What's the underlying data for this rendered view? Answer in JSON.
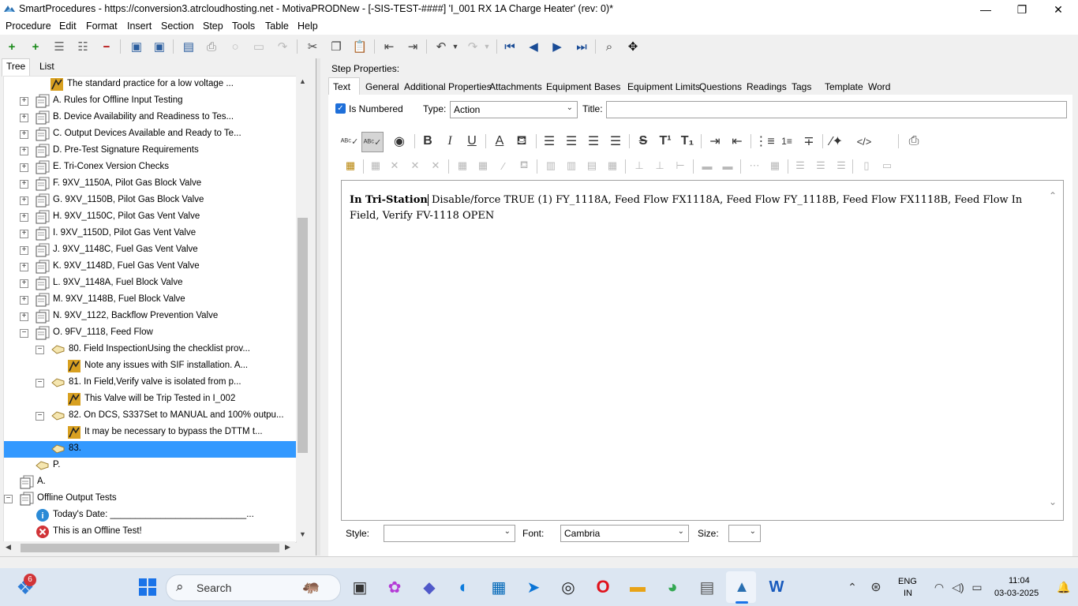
{
  "window": {
    "title": "SmartProcedures - https://conversion3.atrcloudhosting.net - MotivaPRODNew - [-SIS-TEST-####] 'I_001 RX 1A Charge Heater' (rev: 0)*",
    "minimize": "—",
    "maximize": "❐",
    "close": "✕"
  },
  "menu": [
    "Procedure",
    "Edit",
    "Format",
    "Insert",
    "Section",
    "Step",
    "Tools",
    "Table",
    "Help"
  ],
  "left_tabs": {
    "tree": "Tree",
    "list": "List"
  },
  "tree": [
    {
      "label": "The standard practice for a low voltage ...",
      "icon": "note"
    },
    {
      "label": "A. Rules for Offline Input Testing",
      "icon": "section",
      "exp": "+"
    },
    {
      "label": "B. Device Availability and Readiness to Tes...",
      "icon": "section",
      "exp": "+"
    },
    {
      "label": "C. Output Devices Available and Ready to Te...",
      "icon": "section",
      "exp": "+"
    },
    {
      "label": "D. Pre-Test Signature Requirements",
      "icon": "section",
      "exp": "+"
    },
    {
      "label": "E. Tri-Conex Version Checks",
      "icon": "section",
      "exp": "+"
    },
    {
      "label": "F. 9XV_1150A, Pilot Gas Block Valve",
      "icon": "section",
      "exp": "+"
    },
    {
      "label": "G. 9XV_1150B, Pilot Gas Block Valve",
      "icon": "section",
      "exp": "+"
    },
    {
      "label": "H. 9XV_1150C, Pilot Gas Vent Valve",
      "icon": "section",
      "exp": "+"
    },
    {
      "label": "I. 9XV_1150D, Pilot Gas Vent Valve",
      "icon": "section",
      "exp": "+"
    },
    {
      "label": "J. 9XV_1148C, Fuel Gas Vent Valve",
      "icon": "section",
      "exp": "+"
    },
    {
      "label": "K. 9XV_1148D, Fuel Gas Vent Valve",
      "icon": "section",
      "exp": "+"
    },
    {
      "label": "L. 9XV_1148A, Fuel Block Valve",
      "icon": "section",
      "exp": "+"
    },
    {
      "label": "M. 9XV_1148B, Fuel Block Valve",
      "icon": "section",
      "exp": "+"
    },
    {
      "label": "N. 9XV_1122, Backflow Prevention Valve",
      "icon": "section",
      "exp": "+"
    },
    {
      "label": "O. 9FV_1118, Feed Flow",
      "icon": "section",
      "exp": "−"
    },
    {
      "label": "80. Field InspectionUsing the checklist prov...",
      "icon": "step",
      "exp": "−"
    },
    {
      "label": "Note any issues with SIF installation. A...",
      "icon": "note"
    },
    {
      "label": "81. In Field,Verify valve is isolated from p...",
      "icon": "step",
      "exp": "−"
    },
    {
      "label": "This Valve will be Trip Tested in I_002",
      "icon": "note"
    },
    {
      "label": "82. On DCS, S337Set to MANUAL and 100% outpu...",
      "icon": "step",
      "exp": "−"
    },
    {
      "label": "It may be necessary to bypass the DTTM t...",
      "icon": "note"
    },
    {
      "label": "83.",
      "icon": "step",
      "selected": true
    },
    {
      "label": "P.",
      "icon": "step"
    },
    {
      "label": "A.",
      "icon": "section"
    },
    {
      "label": "Offline Output Tests",
      "icon": "section",
      "exp": "−"
    },
    {
      "label": "Today's Date: ___________________________...",
      "icon": "info"
    },
    {
      "label": "This is an Offline Test!",
      "icon": "error"
    }
  ],
  "step_properties_label": "Step Properties:",
  "right_tabs": [
    "Text",
    "General",
    "Additional Properties",
    "Attachments",
    "Equipment",
    "Bases",
    "Equipment Limits",
    "Questions",
    "Readings",
    "Tags",
    "Template",
    "Word"
  ],
  "is_numbered": {
    "label": "Is Numbered",
    "checked": true
  },
  "type": {
    "label": "Type:",
    "value": "Action"
  },
  "title_field": {
    "label": "Title:",
    "value": ""
  },
  "editor": {
    "bold_text": "In Tri-Station",
    "text": " Disable/force TRUE (1) FY_1118A, Feed Flow FX1118A, Feed Flow FY_1118B, Feed Flow FX1118B, Feed Flow In Field, Verify FV-1118 OPEN"
  },
  "style_field": {
    "label": "Style:",
    "value": ""
  },
  "font_field": {
    "label": "Font:",
    "value": "Cambria"
  },
  "size_field": {
    "label": "Size:",
    "value": ""
  },
  "taskbar": {
    "search_placeholder": "Search",
    "badge": "6",
    "lang": "ENG",
    "region": "IN",
    "time": "11:04",
    "date": "03-03-2025"
  }
}
